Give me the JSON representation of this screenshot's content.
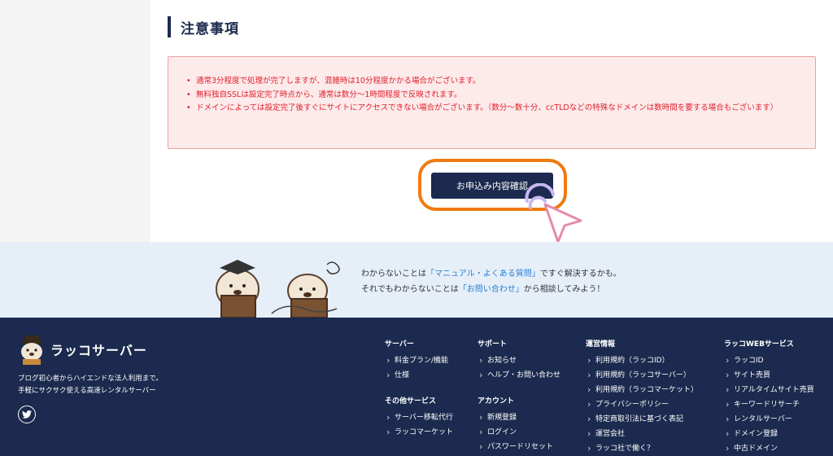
{
  "section": {
    "title": "注意事項"
  },
  "notices": [
    "通常3分程度で処理が完了しますが、混雑時は10分程度かかる場合がございます。",
    "無料独自SSLは設定完了時点から、通常は数分〜1時間程度で反映されます。",
    "ドメインによっては設定完了後すぐにサイトにアクセスできない場合がございます。（数分〜数十分、ccTLDなどの特殊なドメインは数時間を要する場合もございます）"
  ],
  "bullet": "•",
  "confirm_button": "お申込み内容確認",
  "help": {
    "line1_pre": "わからないことは",
    "line1_link": "「マニュアル・よくある質問」",
    "line1_post": "ですぐ解決するかも。",
    "line2_pre": "それでもわからないことは",
    "line2_link": "「お問い合わせ」",
    "line2_post": "から相談してみよう！"
  },
  "footer": {
    "brand": "ラッコサーバー",
    "desc1": "ブログ初心者からハイエンドな法人利用まで。",
    "desc2": "手軽にサクサク使える高速レンタルサーバー",
    "columns": [
      {
        "head": "サーバー",
        "items": [
          "料金プラン/機能",
          "仕様"
        ]
      },
      {
        "head": "その他サービス",
        "items": [
          "サーバー移転代行",
          "ラッコマーケット"
        ]
      },
      {
        "head": "サポート",
        "items": [
          "お知らせ",
          "ヘルプ・お問い合わせ"
        ]
      },
      {
        "head": "アカウント",
        "items": [
          "新規登録",
          "ログイン",
          "パスワードリセット"
        ]
      },
      {
        "head": "運営情報",
        "items": [
          "利用規約（ラッコID）",
          "利用規約（ラッコサーバー）",
          "利用規約（ラッコマーケット）",
          "プライバシーポリシー",
          "特定商取引法に基づく表記",
          "運営会社",
          "ラッコ社で働く？"
        ]
      },
      {
        "head": "ラッコWEBサービス",
        "items": [
          "ラッコID",
          "サイト売買",
          "リアルタイムサイト売買",
          "キーワードリサーチ",
          "レンタルサーバー",
          "ドメイン登録",
          "中古ドメイン"
        ]
      }
    ]
  },
  "colors": {
    "navy": "#1b2a4e",
    "accent_orange": "#f07a10",
    "notice_red": "#e0202c",
    "link_blue": "#2b7fd3"
  },
  "icons": {
    "cursor": "pointer-arrow-icon",
    "social": "twitter-icon"
  }
}
